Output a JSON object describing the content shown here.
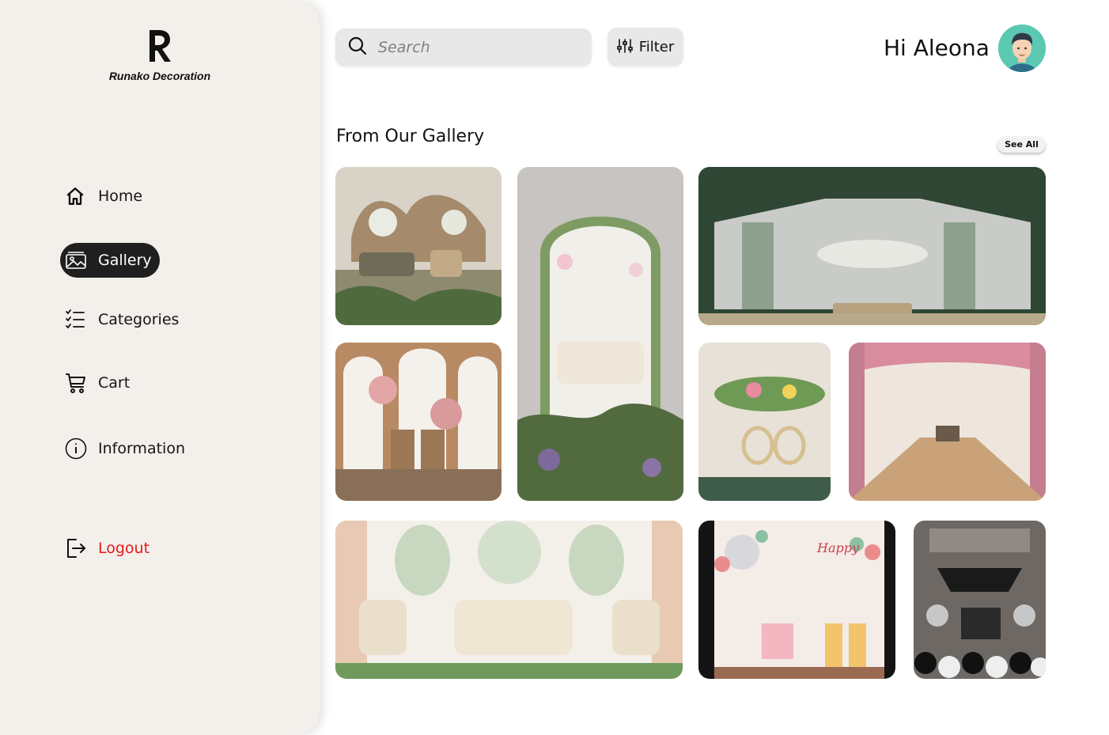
{
  "brand": {
    "name": "Runako Decoration"
  },
  "nav": {
    "home": "Home",
    "gallery": "Gallery",
    "categories": "Categories",
    "cart": "Cart",
    "information": "Information",
    "logout": "Logout"
  },
  "header": {
    "search_placeholder": "Search",
    "filter_label": "Filter",
    "greeting": "Hi Aleona"
  },
  "gallery": {
    "title": "From Our Gallery",
    "see_all": "See All"
  },
  "colors": {
    "sidebar_bg": "#f3efeb",
    "active_nav": "#1f1f1f",
    "logout": "#e81818",
    "avatar_bg": "#5bc9b2"
  }
}
